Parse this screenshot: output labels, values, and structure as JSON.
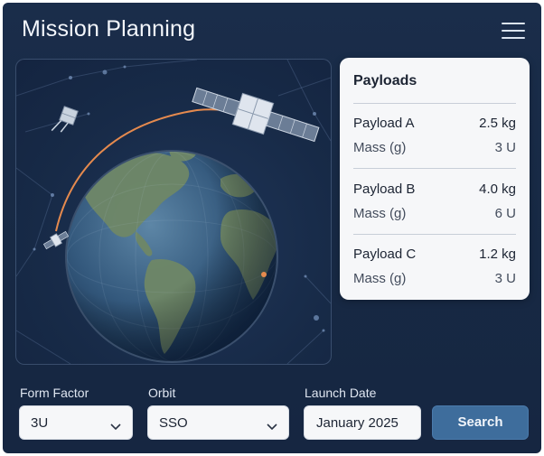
{
  "header": {
    "title": "Mission Planning",
    "menu_icon": "hamburger-menu-icon"
  },
  "payloads": {
    "title": "Payloads",
    "items": [
      {
        "name": "Payload A",
        "weight": "2.5 kg",
        "mass_label": "Mass (g)",
        "units": "3 U"
      },
      {
        "name": "Payload B",
        "weight": "4.0 kg",
        "mass_label": "Mass (g)",
        "units": "6 U"
      },
      {
        "name": "Payload C",
        "weight": "1.2 kg",
        "mass_label": "Mass (g)",
        "units": "3 U"
      }
    ]
  },
  "form": {
    "form_factor": {
      "label": "Form Factor",
      "value": "3U"
    },
    "orbit": {
      "label": "Orbit",
      "value": "SSO"
    },
    "launch_date": {
      "label": "Launch Date",
      "value": "January 2025"
    },
    "search_label": "Search"
  },
  "colors": {
    "background": "#172944",
    "accent": "#3e6d9c",
    "orbit_path": "#e58a4e",
    "card": "#f6f7f9"
  }
}
